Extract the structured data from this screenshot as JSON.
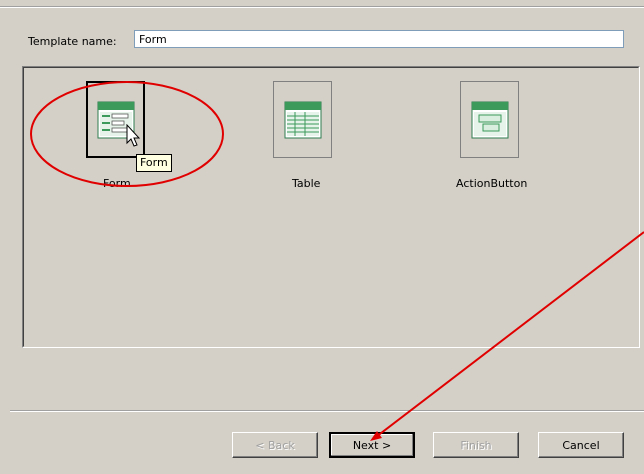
{
  "template_name": {
    "label": "Template name:",
    "value": "Form"
  },
  "templates": [
    {
      "label": "Form",
      "icon": "form-template-icon",
      "selected": true
    },
    {
      "label": "Table",
      "icon": "table-template-icon",
      "selected": false
    },
    {
      "label": "ActionButton",
      "icon": "action-button-template-icon",
      "selected": false
    }
  ],
  "tooltip": "Form",
  "buttons": {
    "back": "< Back",
    "next": "Next >",
    "finish": "Finish",
    "cancel": "Cancel"
  },
  "colors": {
    "annotation": "#e00000",
    "icon_green": "#3c9a5a",
    "tooltip_bg": "#ffffe1"
  }
}
